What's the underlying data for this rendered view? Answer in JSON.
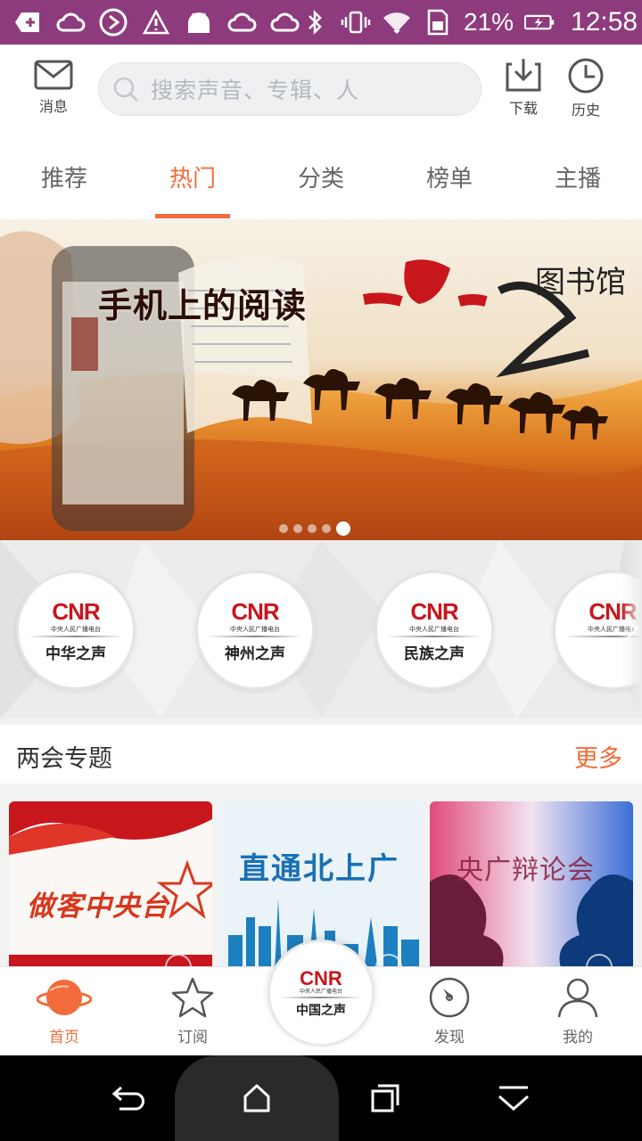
{
  "status_bar": {
    "battery": "21%",
    "time": "12:58",
    "left_icons": [
      "add-icon",
      "cloud-icon",
      "play-circle-icon",
      "warning-icon",
      "android-icon",
      "cloud-icon",
      "cloud-icon"
    ],
    "right_icons": [
      "bluetooth-icon",
      "vibrate-icon",
      "wifi-icon",
      "sim-icon",
      "battery-icon"
    ]
  },
  "topbar": {
    "messages_label": "消息",
    "search_placeholder": "搜索声音、专辑、人",
    "download_label": "下载",
    "history_label": "历史"
  },
  "tabs": [
    {
      "label": "推荐",
      "active": false
    },
    {
      "label": "热门",
      "active": true
    },
    {
      "label": "分类",
      "active": false
    },
    {
      "label": "榜单",
      "active": false
    },
    {
      "label": "主播",
      "active": false
    }
  ],
  "banner": {
    "title": "手机上的阅读",
    "logo_text": "一带一路 图书馆",
    "slide_count": 5,
    "active_slide": 5
  },
  "radios": [
    {
      "brand": "CNR",
      "sub": "中央人民广播电台",
      "name": "中华之声"
    },
    {
      "brand": "CNR",
      "sub": "中央人民广播电台",
      "name": "神州之声"
    },
    {
      "brand": "CNR",
      "sub": "中央人民广播电台",
      "name": "民族之声"
    },
    {
      "brand": "CNR",
      "sub": "中央人民广播电台",
      "name": ""
    }
  ],
  "section": {
    "title": "两会专题",
    "more_label": "更多"
  },
  "cards": [
    {
      "title": "做客中央台"
    },
    {
      "title": "直通北上广"
    },
    {
      "title": "央广辩论会"
    }
  ],
  "bottom_nav": {
    "home_label": "首页",
    "subscribe_label": "订阅",
    "center_brand": "CNR",
    "center_sub": "中央人民广播电台",
    "center_name": "中国之声",
    "discover_label": "发现",
    "mine_label": "我的"
  },
  "colors": {
    "status_bar": "#8e3b7d",
    "accent": "#f26b3a",
    "cnr_red": "#c8161d"
  }
}
